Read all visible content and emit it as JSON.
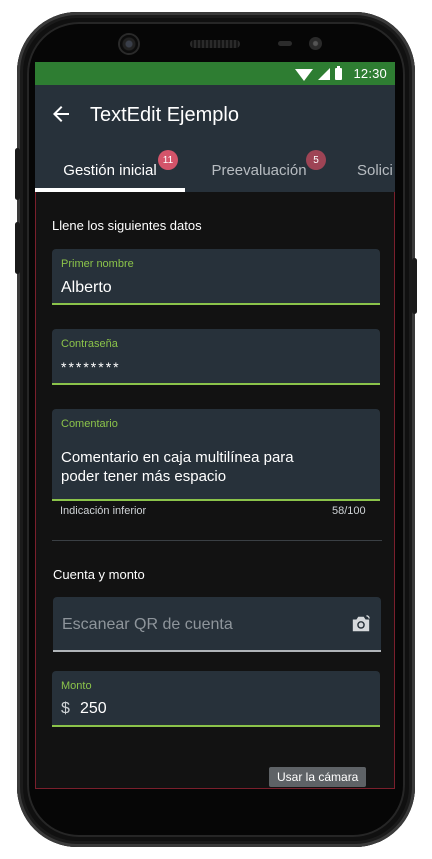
{
  "status_bar": {
    "time": "12:30"
  },
  "app_bar": {
    "title": "TextEdit Ejemplo",
    "back_icon": "arrow-back-icon"
  },
  "tabs": [
    {
      "label": "Gestión inicial",
      "badge": "11",
      "active": true
    },
    {
      "label": "Preevaluación",
      "badge": "5",
      "active": false
    },
    {
      "label": "Solici",
      "badge": "",
      "active": false
    }
  ],
  "form": {
    "section1_title": "Llene los siguientes datos",
    "first_name": {
      "label": "Primer nombre",
      "value": "Alberto"
    },
    "password": {
      "label": "Contraseña",
      "value": "********"
    },
    "comment": {
      "label": "Comentario",
      "value_line1": "Comentario en caja multilínea para",
      "value_line2": "poder tener más espacio",
      "helper": "Indicación inferior",
      "counter": "58/100"
    },
    "section2_title": "Cuenta y monto",
    "qr": {
      "placeholder": "Escanear QR de cuenta",
      "tooltip": "Usar la cámara",
      "icon": "camera-icon"
    },
    "amount": {
      "label": "Monto",
      "prefix": "$",
      "value": "250"
    }
  },
  "colors": {
    "status_bar": "#2e7d32",
    "app_bar": "#27313a",
    "accent": "#8bc34a",
    "badge": "#d4546a",
    "background": "#121212"
  }
}
